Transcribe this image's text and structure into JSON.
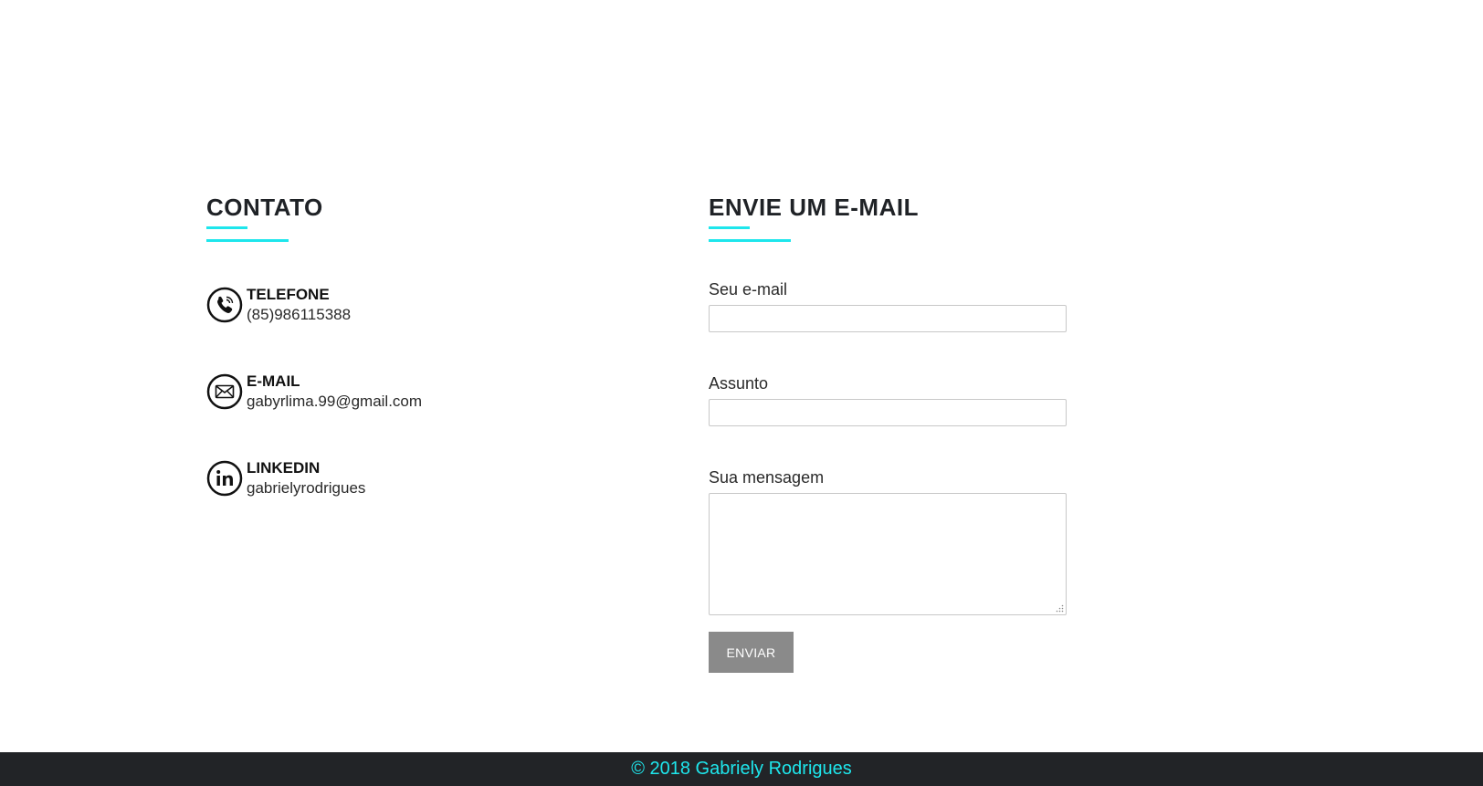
{
  "colors": {
    "accent": "#1ee6ec",
    "footer_bg": "#222427",
    "button_bg": "#8a8a8a"
  },
  "contact": {
    "title": "CONTATO",
    "items": [
      {
        "icon": "phone-icon",
        "label": "TELEFONE",
        "value": "(85)986115388"
      },
      {
        "icon": "mail-icon",
        "label": "E-MAIL",
        "value": "gabyrlima.99@gmail.com"
      },
      {
        "icon": "linkedin-icon",
        "label": "LINKEDIN",
        "value": "gabrielyrodrigues"
      }
    ]
  },
  "form": {
    "title": "ENVIE UM E-MAIL",
    "email_label": "Seu e-mail",
    "email_value": "",
    "subject_label": "Assunto",
    "subject_value": "",
    "message_label": "Sua mensagem",
    "message_value": "",
    "submit_label": "ENVIAR"
  },
  "footer": {
    "text": "© 2018 Gabriely Rodrigues"
  }
}
